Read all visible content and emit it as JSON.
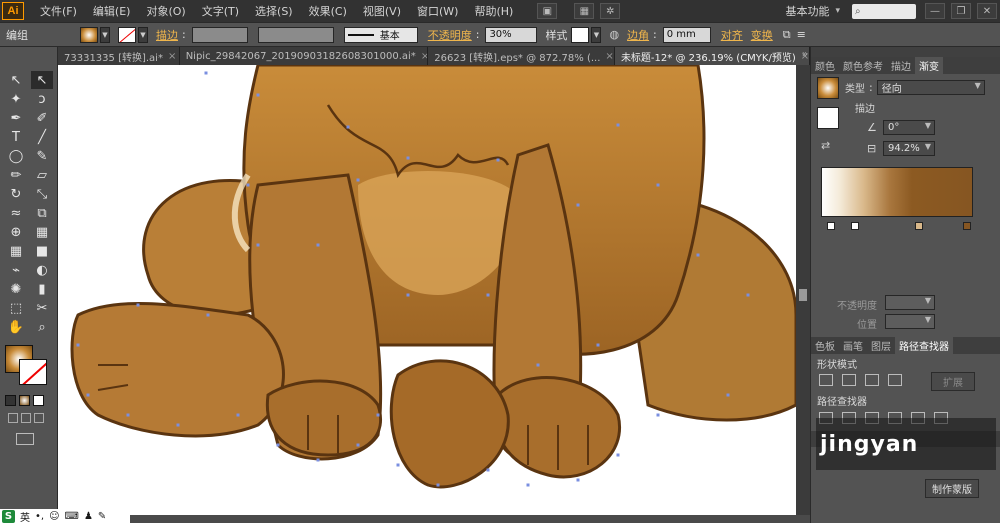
{
  "app": {
    "logo": "Ai"
  },
  "menu": [
    "文件(F)",
    "编辑(E)",
    "对象(O)",
    "文字(T)",
    "选择(S)",
    "效果(C)",
    "视图(V)",
    "窗口(W)",
    "帮助(H)"
  ],
  "menu_right": {
    "workspace": "基本功能",
    "workspace_arrow": "▾",
    "search_placeholder": ""
  },
  "control": {
    "object_type": "编组",
    "stroke_label": "描边",
    "stroke_line_label": "基本",
    "opacity_label": "不透明度",
    "opacity_value": "30%",
    "style_label": "样式",
    "corner_label": "边角",
    "corner_value": "0 mm",
    "align_label": "对齐",
    "transform_label": "变换"
  },
  "tabs": [
    {
      "label": "73331335 [转换].ai*",
      "active": false
    },
    {
      "label": "Nipic_29842067_20190903182608301000.ai*",
      "active": false
    },
    {
      "label": "26623 [转换].eps* @ 872.78% (...",
      "active": false
    },
    {
      "label": "未标题-12* @ 236.19% (CMYK/预览)",
      "active": true
    }
  ],
  "gradient_panel": {
    "tabs": [
      "颜色",
      "颜色参考",
      "描边",
      "渐变"
    ],
    "active_tab": "渐变",
    "type_label": "类型",
    "type_value": "径向",
    "stroke_label": "描边",
    "angle_value": "0°",
    "ratio_value": "94.2%",
    "opacity_label": "不透明度",
    "position_label": "位置",
    "colors": {
      "start": "#ffffff",
      "end": "#865622"
    }
  },
  "pathfinder_panel": {
    "tabs": [
      "色板",
      "画笔",
      "图层",
      "路径查找器"
    ],
    "active_tab": "路径查找器",
    "shape_modes_label": "形状模式",
    "expand_button": "扩展",
    "pathfinders_label": "路径查找器"
  },
  "layer_panel": {
    "make_mask_button": "制作蒙版"
  },
  "watermark": {
    "text": "jingyan"
  },
  "ime": {
    "logo": "S",
    "mode": "英"
  }
}
